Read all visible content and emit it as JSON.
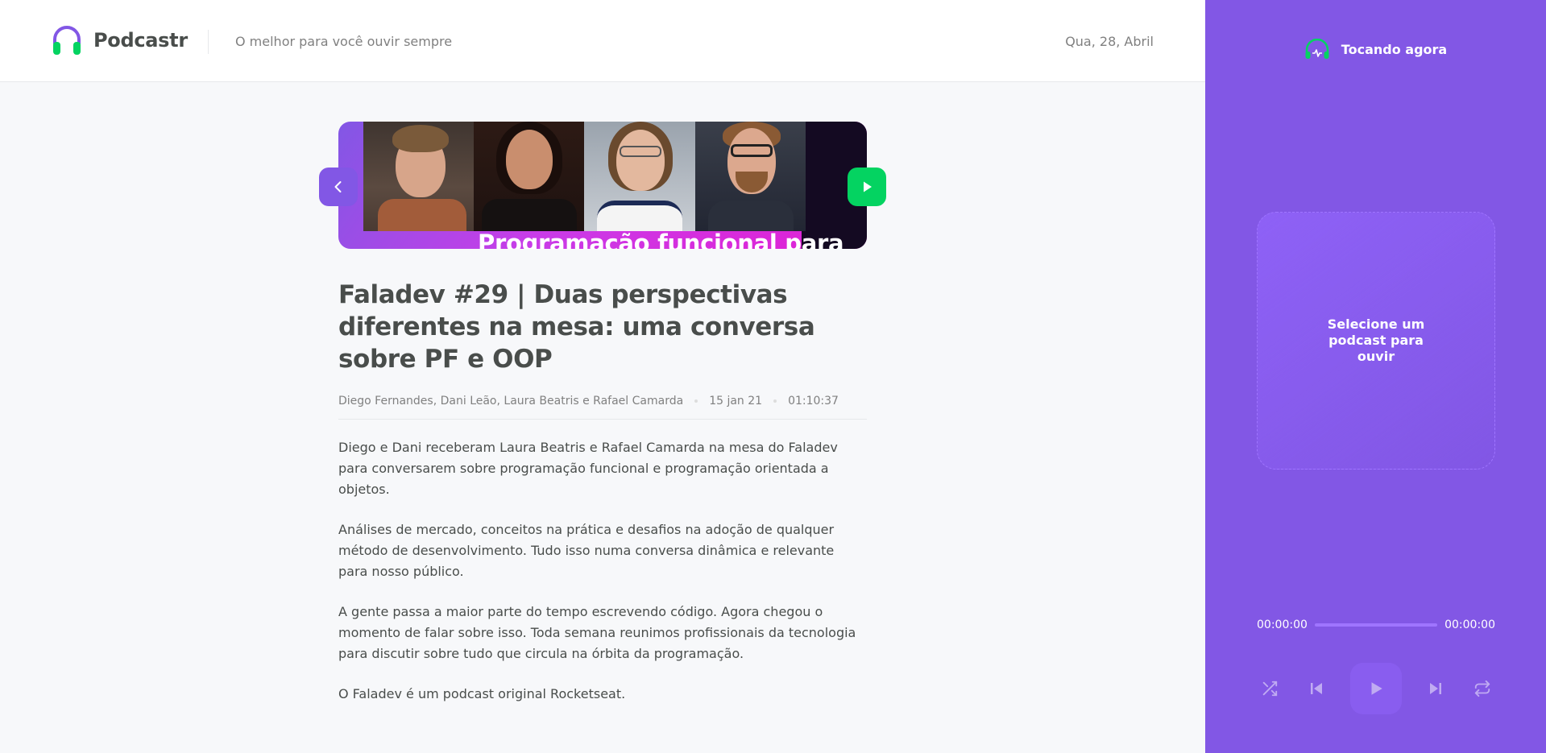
{
  "header": {
    "app_name": "Podcastr",
    "tagline": "O melhor para você ouvir sempre",
    "date": "Qua, 28, Abril"
  },
  "episode": {
    "thumbnail_caption": "Programação funcional para",
    "title": "Faladev #29 | Duas perspectivas diferentes na mesa: uma conversa sobre PF e OOP",
    "members": "Diego Fernandes, Dani Leão, Laura Beatris e Rafael Camarda",
    "published_at": "15 jan 21",
    "duration": "01:10:37",
    "description": [
      "Diego e Dani receberam Laura Beatris e Rafael Camarda na mesa do Faladev para conversarem sobre programação funcional e programação orientada a objetos.",
      "Análises de mercado, conceitos na prática e desafios na adoção de qualquer método de desenvolvimento. Tudo isso numa conversa dinâmica e relevante para nosso público.",
      "A gente passa a maior parte do tempo escrevendo código. Agora chegou o momento de falar sobre isso. Toda semana reunimos profissionais da tecnologia para discutir sobre tudo que circula na órbita da programação.",
      "O Faladev é um podcast original Rocketseat."
    ]
  },
  "player": {
    "header_label": "Tocando agora",
    "empty_message": "Selecione um podcast para ouvir",
    "current_time": "00:00:00",
    "total_time": "00:00:00",
    "progress": 0,
    "controls": [
      "shuffle-icon",
      "previous-icon",
      "play-icon",
      "next-icon",
      "repeat-icon"
    ]
  },
  "colors": {
    "primary": "#8257e5",
    "accent_green": "#04d361",
    "background": "#f7f8fa",
    "text": "#494d4b"
  }
}
